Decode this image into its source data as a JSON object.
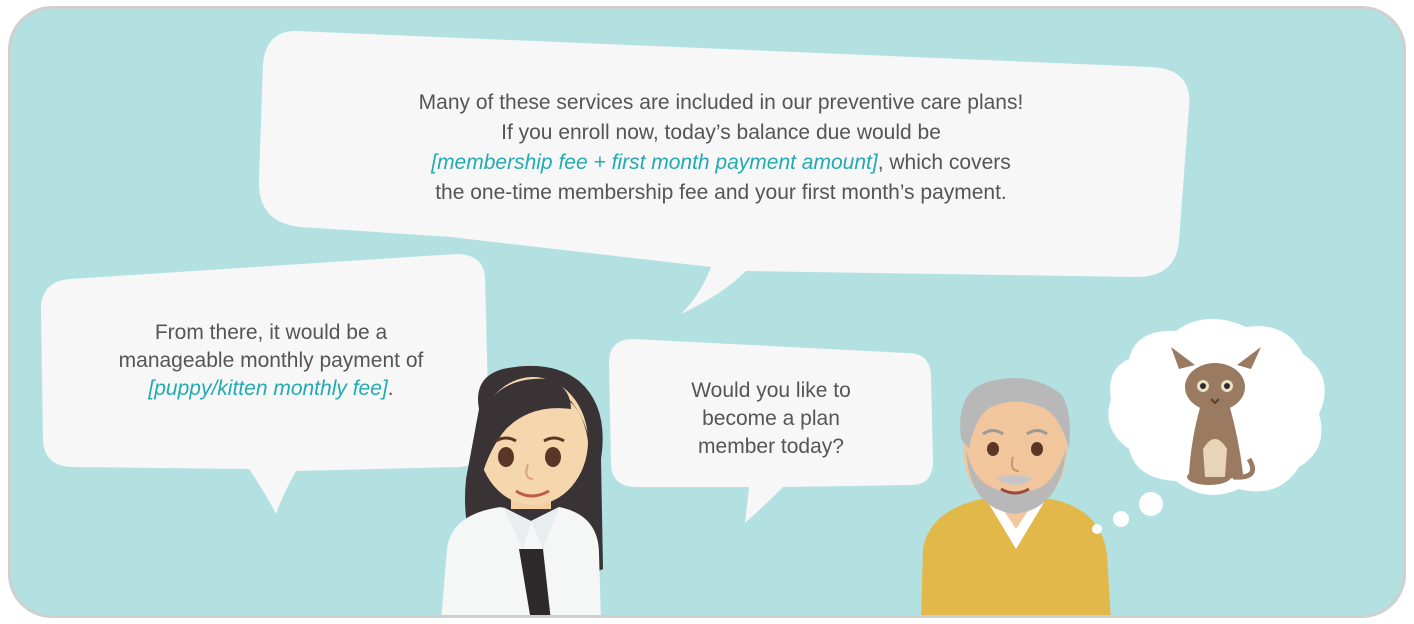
{
  "colors": {
    "background": "#b3e1e2",
    "bubble": "#f7f7f7",
    "text": "#555555",
    "highlight": "#22aab2",
    "woman_shirt": "#f5f7f7",
    "man_sweater": "#e3b84a",
    "cat": "#9a7a60"
  },
  "bubbles": {
    "top": {
      "line1": "Many of these services are included in our preventive care plans!",
      "line2": "If you enroll now, today’s balance due would be",
      "line3_highlight": "[membership fee + first month payment amount]",
      "line3_rest": ", which covers",
      "line4": "the one-time membership fee and your first month’s payment."
    },
    "left": {
      "line1": "From there, it would be a",
      "line2": "manageable monthly payment of",
      "line3_highlight": "[puppy/kitten monthly fee]",
      "line3_rest": "."
    },
    "middle": {
      "line1": "Would you like to",
      "line2": "become a plan",
      "line3": "member today?"
    }
  },
  "characters": {
    "staff": "woman-receptionist-icon",
    "client": "older-man-icon",
    "thought": "cat-icon"
  }
}
